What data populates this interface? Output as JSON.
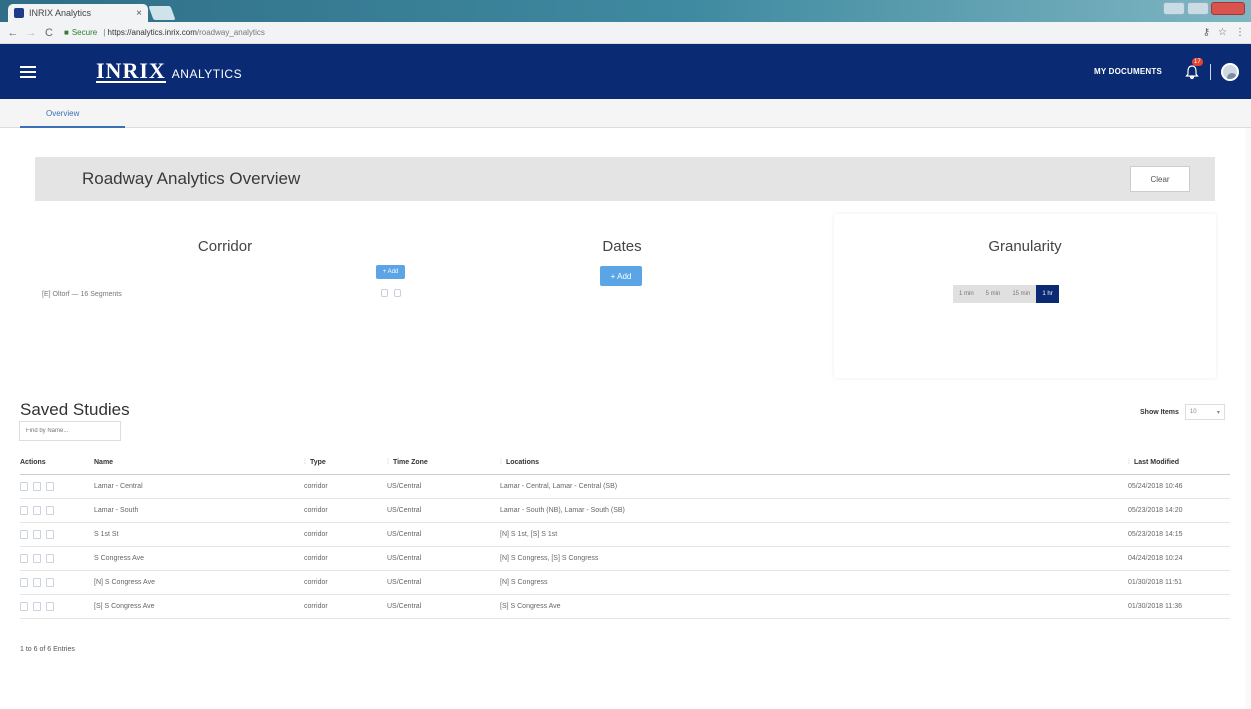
{
  "browser": {
    "tab_title": "INRIX Analytics",
    "tab_close": "×",
    "url_secure": "Secure",
    "url_host": "https://analytics.inrix.com",
    "url_path": "/roadway_analytics"
  },
  "header": {
    "logo_main": "INRIX",
    "logo_sub": "ANALYTICS",
    "my_documents": "MY DOCUMENTS",
    "notification_count": "17"
  },
  "subnav": {
    "tab_overview": "Overview"
  },
  "overview": {
    "title": "Roadway Analytics Overview",
    "clear_label": "Clear",
    "corridor": {
      "title": "Corridor",
      "add_label": "+ Add",
      "item": "[E] Oltorf — 16 Segments"
    },
    "dates": {
      "title": "Dates",
      "add_label": "+ Add"
    },
    "granularity": {
      "title": "Granularity",
      "options": [
        "1 min",
        "5 min",
        "15 min",
        "1 hr"
      ],
      "selected": "1 hr"
    }
  },
  "saved_studies": {
    "title": "Saved Studies",
    "search_placeholder": "Find by Name...",
    "show_items_label": "Show Items",
    "show_items_value": "10",
    "columns": {
      "actions": "Actions",
      "name": "Name",
      "type": "Type",
      "time_zone": "Time Zone",
      "locations": "Locations",
      "last_modified": "Last Modified"
    },
    "rows": [
      {
        "name": "Lamar - Central",
        "type": "corridor",
        "tz": "US/Central",
        "locations": "Lamar - Central, Lamar - Central (SB)",
        "modified": "05/24/2018 10:46"
      },
      {
        "name": "Lamar - South",
        "type": "corridor",
        "tz": "US/Central",
        "locations": "Lamar - South (NB), Lamar - South (SB)",
        "modified": "05/23/2018 14:20"
      },
      {
        "name": "S 1st St",
        "type": "corridor",
        "tz": "US/Central",
        "locations": "[N] S 1st, [S] S 1st",
        "modified": "05/23/2018 14:15"
      },
      {
        "name": "S Congress Ave",
        "type": "corridor",
        "tz": "US/Central",
        "locations": "[N] S Congress, [S] S Congress",
        "modified": "04/24/2018 10:24"
      },
      {
        "name": "[N] S Congress Ave",
        "type": "corridor",
        "tz": "US/Central",
        "locations": "[N] S Congress",
        "modified": "01/30/2018 11:51"
      },
      {
        "name": "[S] S Congress Ave",
        "type": "corridor",
        "tz": "US/Central",
        "locations": "[S] S Congress Ave",
        "modified": "01/30/2018 11:36"
      }
    ],
    "footer": "1 to 6 of 6 Entries"
  }
}
